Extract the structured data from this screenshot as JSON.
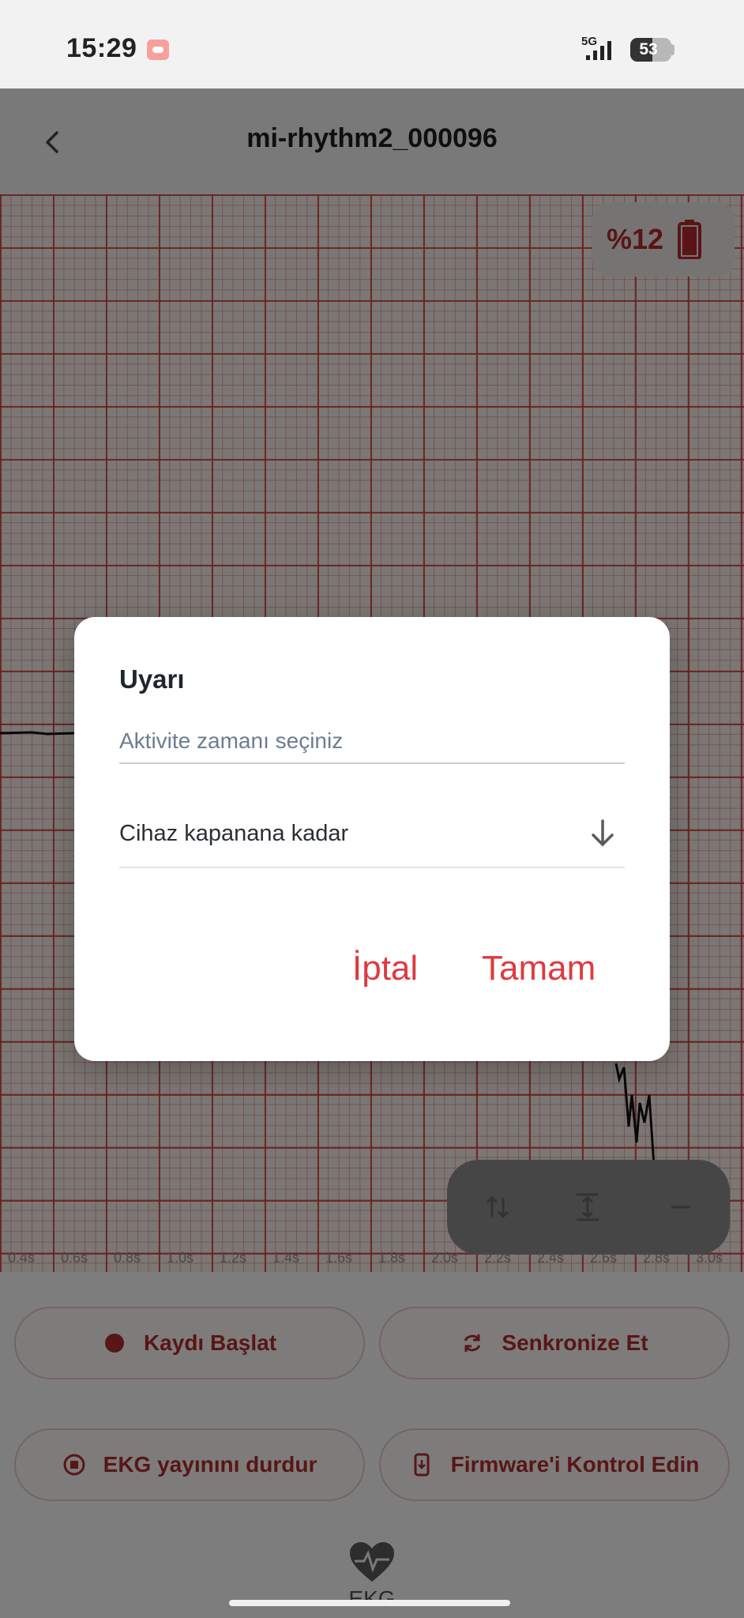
{
  "status_bar": {
    "time": "15:29",
    "network": "5G",
    "battery": "53",
    "battery_level": 0.53
  },
  "header": {
    "title": "mi-rhythm2_000096",
    "back_icon": "chevron-left-icon"
  },
  "ecg": {
    "battery_chip": {
      "text": "%12",
      "level": 0.12,
      "icon": "battery-icon",
      "color": "#b4282a"
    },
    "tools": [
      "swap-vertical-icon",
      "fit-height-icon",
      "minus-icon"
    ],
    "time_ticks": [
      "0.4s",
      "0.6s",
      "0.8s",
      "1.0s",
      "1.2s",
      "1.4s",
      "1.6s",
      "1.8s",
      "2.0s",
      "2.2s",
      "2.4s",
      "2.6s",
      "2.8s",
      "3.0s"
    ]
  },
  "actions": {
    "start_record": {
      "label": "Kaydı Başlat",
      "icon": "record-dot-icon"
    },
    "sync": {
      "label": "Senkronize Et",
      "icon": "sync-icon"
    },
    "stop_stream": {
      "label": "EKG yayınını durdur",
      "icon": "stop-circle-icon"
    },
    "firmware": {
      "label": "Firmware'i Kontrol Edin",
      "icon": "phone-update-icon"
    }
  },
  "nav": {
    "label": "EKG",
    "icon": "heart-pulse-icon"
  },
  "dialog": {
    "title": "Uyarı",
    "activity_placeholder": "Aktivite zamanı seçiniz",
    "selected_value": "Cihaz kapanana kadar",
    "arrow_icon": "arrow-down-icon",
    "cancel_label": "İptal",
    "ok_label": "Tamam"
  },
  "colors": {
    "accent": "#e0393f",
    "button_text": "#b12d2d",
    "grid_major": "#d23c3c",
    "paper": "#f6eee8"
  }
}
